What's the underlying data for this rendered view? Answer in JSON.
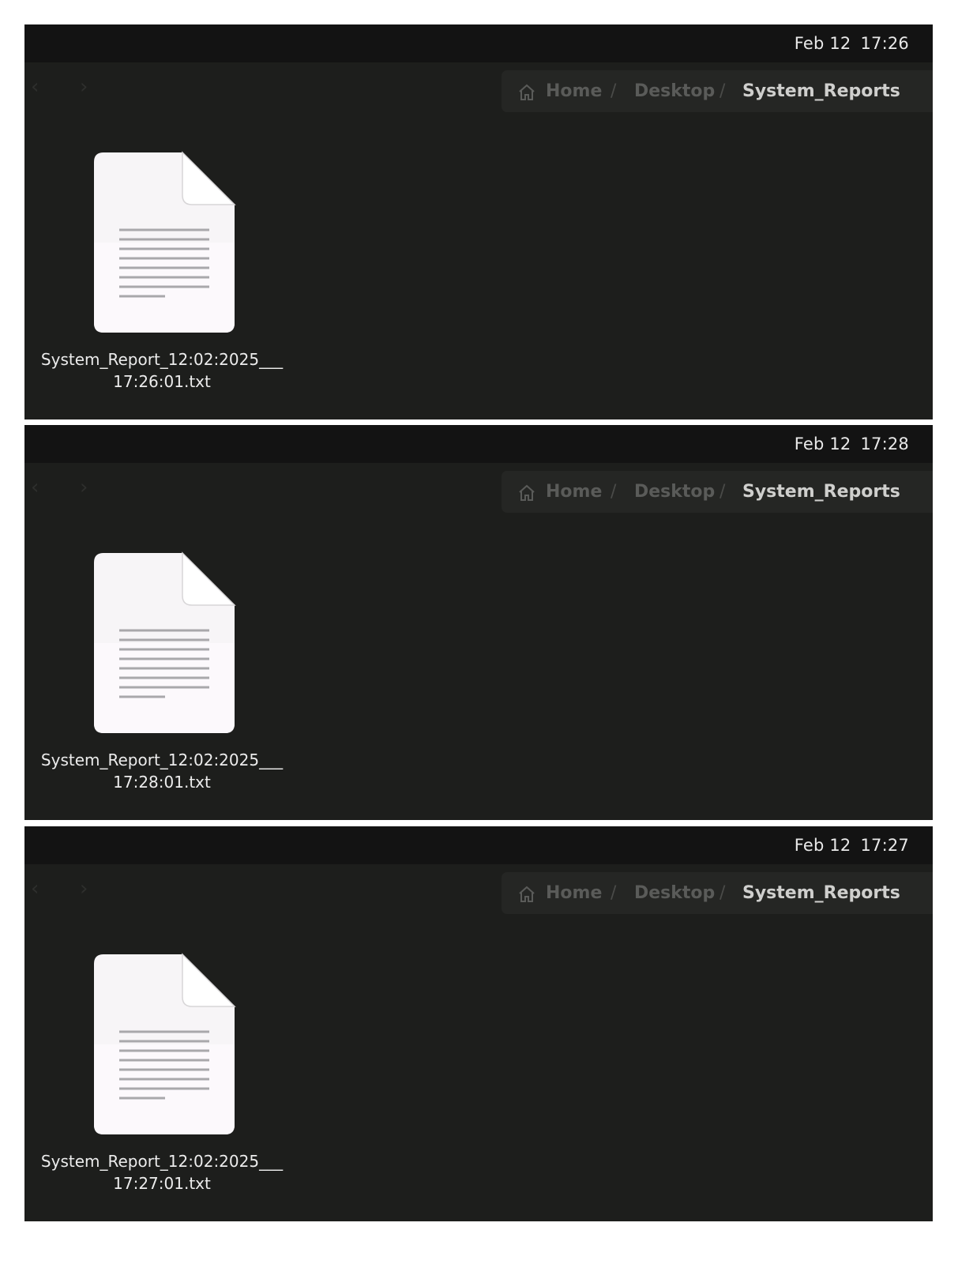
{
  "panels": [
    {
      "clock": {
        "date": "Feb 12",
        "time": "17:26"
      },
      "breadcrumb": {
        "home": "Home",
        "separator": "/",
        "desktop": "Desktop",
        "current": "System_Reports"
      },
      "file": {
        "name_line1": "System_Report_12:02:2025___",
        "name_line2": "17:26:01.txt",
        "icon": "text-file-icon"
      }
    },
    {
      "clock": {
        "date": "Feb 12",
        "time": "17:28"
      },
      "breadcrumb": {
        "home": "Home",
        "separator": "/",
        "desktop": "Desktop",
        "current": "System_Reports"
      },
      "file": {
        "name_line1": "System_Report_12:02:2025___",
        "name_line2": "17:28:01.txt",
        "icon": "text-file-icon"
      }
    },
    {
      "clock": {
        "date": "Feb 12",
        "time": "17:27"
      },
      "breadcrumb": {
        "home": "Home",
        "separator": "/",
        "desktop": "Desktop",
        "current": "System_Reports"
      },
      "file": {
        "name_line1": "System_Report_12:02:2025___",
        "name_line2": "17:27:01.txt",
        "icon": "text-file-icon"
      }
    }
  ],
  "nav": {
    "back_glyph": "‹",
    "forward_glyph": "›"
  },
  "colors": {
    "background": "#1d1e1c",
    "topbar": "#131313",
    "pathbar": "#252624",
    "text": "#ececec"
  }
}
